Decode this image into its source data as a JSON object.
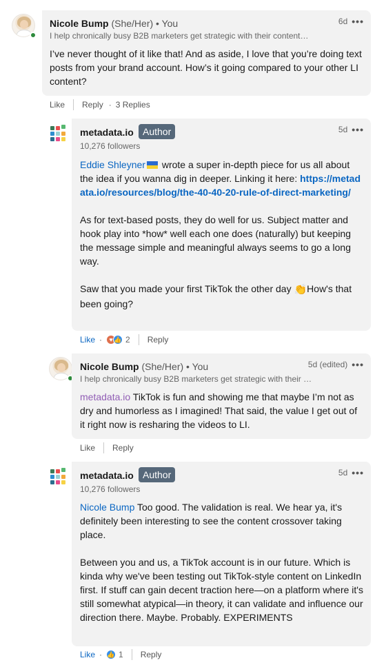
{
  "comments": [
    {
      "author": "Nicole Bump",
      "pronouns": "(She/Her)",
      "degree": "• You",
      "headline": "I help chronically busy B2B marketers get strategic with their content…",
      "time": "6d",
      "body": [
        "I’ve never thought of it like that! And as aside, I love that you’re doing text posts from your brand account. How’s it going compared to your other LI content?"
      ],
      "actions": {
        "like": "Like",
        "reply": "Reply",
        "replies": "3 Replies"
      }
    },
    {
      "author": "metadata.io",
      "badge": "Author",
      "followers": "10,276 followers",
      "time": "5d",
      "mention": "Eddie Shleyner",
      "body_after_mention": " wrote a super in-depth piece for us all about the idea if you wanna dig in deeper. Linking it here: ",
      "link": "https://metadata.io/resources/blog/the-40-40-20-rule-of-direct-marketing/",
      "body2": "As for text-based posts, they do well for us. Subject matter and hook play into *how* well each one does (naturally) but keeping the message simple and meaningful always seems to go a long way.",
      "body3a": "Saw that you made your first TikTok the other day ",
      "body3b": "How's that been going?",
      "actions": {
        "like": "Like",
        "reaction_count": "2",
        "reply": "Reply"
      }
    },
    {
      "author": "Nicole Bump",
      "pronouns": "(She/Her)",
      "degree": "• You",
      "headline": "I help chronically busy B2B marketers get strategic with their …",
      "time": "5d (edited)",
      "mention": "metadata.io",
      "body_after_mention": " TikTok is fun and showing me that maybe I’m not as dry and humorless as I imagined! That said, the value I get out of it right now is resharing the videos to LI.",
      "actions": {
        "like": "Like",
        "reply": "Reply"
      }
    },
    {
      "author": "metadata.io",
      "badge": "Author",
      "followers": "10,276 followers",
      "time": "5d",
      "mention": "Nicole Bump",
      "body_after_mention": " Too good. The validation is real. We hear ya, it's definitely been interesting to see the content crossover taking place.",
      "body2": "Between you and us, a TikTok account is in our future. Which is kinda why we've been testing out TikTok-style content on LinkedIn first. If stuff can gain decent traction here—on a platform where it's still somewhat atypical—in theory, it can validate and influence our direction there. Maybe. Probably. EXPERIMENTS",
      "actions": {
        "like": "Like",
        "reaction_count": "1",
        "reply": "Reply"
      }
    }
  ],
  "icons": {
    "more": "more-options-icon",
    "online": "online-status-icon",
    "flag": "ukraine-flag-icon",
    "clap": "clapping-hands-icon",
    "love": "love-reaction-icon",
    "like": "like-reaction-icon"
  },
  "colors": {
    "bubble": "#f2f2f2",
    "mention": "#0a66c2",
    "mention_company": "#915eb5",
    "badge": "#56687a",
    "online": "#2e8a3c"
  }
}
